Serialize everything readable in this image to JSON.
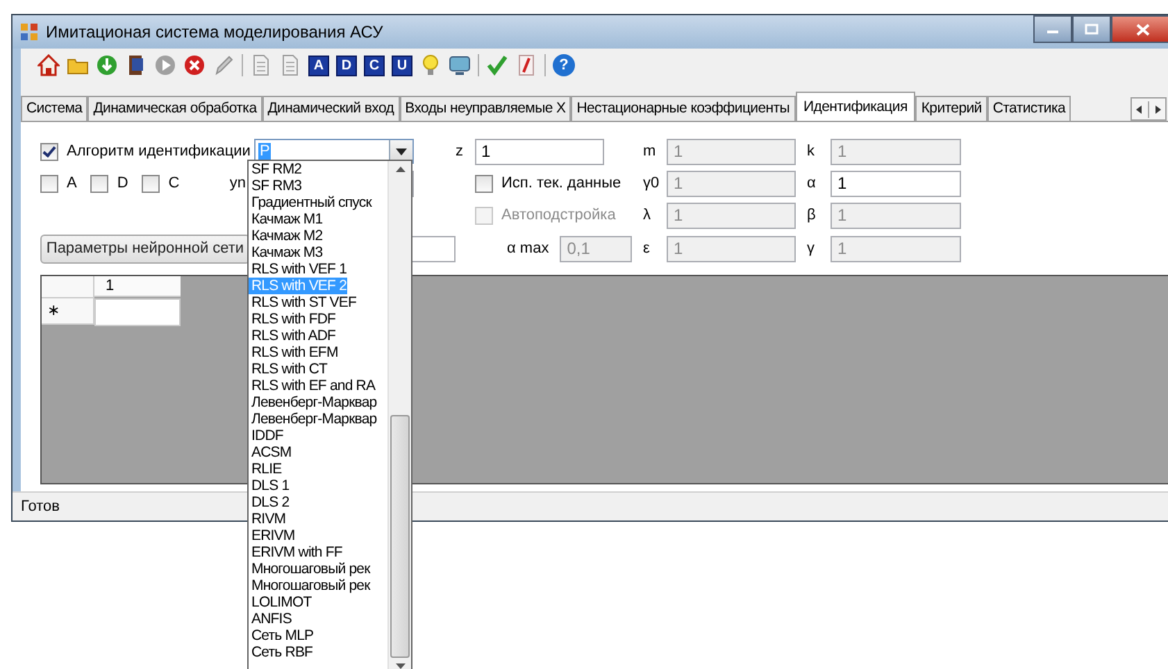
{
  "window": {
    "title": "Имитационая система моделирования АСУ"
  },
  "toolbar": [
    {
      "kind": "home"
    },
    {
      "kind": "folder"
    },
    {
      "kind": "download"
    },
    {
      "kind": "book"
    },
    {
      "kind": "play"
    },
    {
      "kind": "stop"
    },
    {
      "kind": "pencil"
    },
    {
      "kind": "separator"
    },
    {
      "kind": "page"
    },
    {
      "kind": "page"
    },
    {
      "kind": "letter",
      "label": "A"
    },
    {
      "kind": "letter",
      "label": "D"
    },
    {
      "kind": "letter",
      "label": "C"
    },
    {
      "kind": "letter",
      "label": "U"
    },
    {
      "kind": "bulb"
    },
    {
      "kind": "monitor"
    },
    {
      "kind": "separator"
    },
    {
      "kind": "check"
    },
    {
      "kind": "script"
    },
    {
      "kind": "separator"
    },
    {
      "kind": "help",
      "label": "?"
    }
  ],
  "tabs": [
    {
      "label": "Система",
      "selected": false
    },
    {
      "label": "Динамическая обработка",
      "selected": false
    },
    {
      "label": "Динамический вход",
      "selected": false
    },
    {
      "label": "Входы неуправляемые X",
      "selected": false
    },
    {
      "label": "Нестационарные коэффициенты",
      "selected": false
    },
    {
      "label": "Идентификация",
      "selected": true
    },
    {
      "label": "Критерий",
      "selected": false
    },
    {
      "label": "Статистика",
      "selected": false
    }
  ],
  "algorithm": {
    "label": "Алгоритм идентификации",
    "checked": true,
    "value": "P"
  },
  "flags": [
    {
      "label": "A",
      "checked": false
    },
    {
      "label": "D",
      "checked": false
    },
    {
      "label": "C",
      "checked": false
    }
  ],
  "yn_label": "yn",
  "z": {
    "label": "z",
    "value": "1",
    "disabled": false
  },
  "use_current": {
    "label": "Исп. тек. данные",
    "checked": false,
    "disabled": false
  },
  "autotune": {
    "label": "Автоподстройка",
    "checked": false,
    "disabled": true
  },
  "neural_button": "Параметры нейронной сети",
  "alpha_max": {
    "label": "α max",
    "value": "0,1",
    "disabled": true
  },
  "params": [
    {
      "label": "m",
      "value": "1",
      "disabled": true
    },
    {
      "label": "k",
      "value": "1",
      "disabled": true
    },
    {
      "label": "γ0",
      "value": "1",
      "disabled": true
    },
    {
      "label": "α",
      "value": "1",
      "disabled": false
    },
    {
      "label": "λ",
      "value": "1",
      "disabled": true
    },
    {
      "label": "β",
      "value": "1",
      "disabled": true
    },
    {
      "label": "ε",
      "value": "1",
      "disabled": true
    },
    {
      "label": "γ",
      "value": "1",
      "disabled": true
    }
  ],
  "grid": {
    "columns": [
      "1"
    ],
    "new_row_marker": "∗"
  },
  "dropdown": {
    "items": [
      {
        "label": "SF RM2",
        "selected": false
      },
      {
        "label": "SF RM3",
        "selected": false
      },
      {
        "label": "Градиентный спуск",
        "selected": false
      },
      {
        "label": "Качмаж M1",
        "selected": false
      },
      {
        "label": "Качмаж M2",
        "selected": false
      },
      {
        "label": "Качмаж M3",
        "selected": false
      },
      {
        "label": "RLS with VEF 1",
        "selected": false
      },
      {
        "label": "RLS with VEF 2",
        "selected": true
      },
      {
        "label": "RLS with ST VEF",
        "selected": false
      },
      {
        "label": "RLS with FDF",
        "selected": false
      },
      {
        "label": "RLS with ADF",
        "selected": false
      },
      {
        "label": "RLS with EFM",
        "selected": false
      },
      {
        "label": "RLS with CT",
        "selected": false
      },
      {
        "label": "RLS with EF and RA",
        "selected": false
      },
      {
        "label": "Левенберг-Марквар",
        "selected": false
      },
      {
        "label": "Левенберг-Марквар",
        "selected": false
      },
      {
        "label": "IDDF",
        "selected": false
      },
      {
        "label": "ACSM",
        "selected": false
      },
      {
        "label": "RLIE",
        "selected": false
      },
      {
        "label": "DLS 1",
        "selected": false
      },
      {
        "label": "DLS 2",
        "selected": false
      },
      {
        "label": "RIVM",
        "selected": false
      },
      {
        "label": "ERIVM",
        "selected": false
      },
      {
        "label": "ERIVM with FF",
        "selected": false
      },
      {
        "label": "Многошаговый рек",
        "selected": false
      },
      {
        "label": "Многошаговый рек",
        "selected": false
      },
      {
        "label": "LOLIMOT",
        "selected": false
      },
      {
        "label": "ANFIS",
        "selected": false
      },
      {
        "label": "Сеть MLP",
        "selected": false
      },
      {
        "label": "Сеть RBF",
        "selected": false
      }
    ]
  },
  "status_bar": "Готов"
}
